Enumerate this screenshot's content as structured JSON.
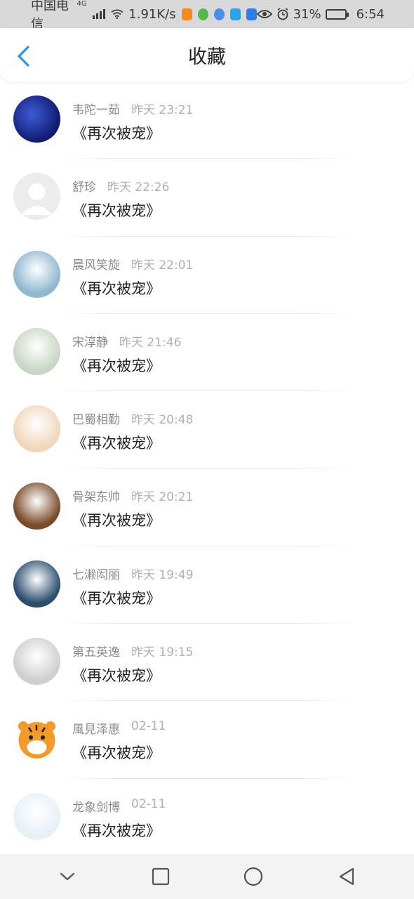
{
  "status_bar": {
    "carrier": "中国电信",
    "network_type": "4G",
    "speed": "1.91K/s",
    "battery": "31%",
    "time": "6:54"
  },
  "header": {
    "title": "收藏",
    "back_icon": "chevron-left-icon"
  },
  "items": [
    {
      "name": "韦陀一茹",
      "time": "昨天 23:21",
      "content": "《再次被宠》",
      "avatar_color": "#1a2a8a"
    },
    {
      "name": "舒珍",
      "time": "昨天 22:26",
      "content": "《再次被宠》",
      "avatar_color": "#e9e9e9"
    },
    {
      "name": "晨风笑旋",
      "time": "昨天 22:01",
      "content": "《再次被宠》",
      "avatar_color": "#8fb8d0"
    },
    {
      "name": "宋淳静",
      "time": "昨天 21:46",
      "content": "《再次被宠》",
      "avatar_color": "#c9d6c4"
    },
    {
      "name": "巴蜀相勤",
      "time": "昨天 20:48",
      "content": "《再次被宠》",
      "avatar_color": "#f0d7bc"
    },
    {
      "name": "骨架东帅",
      "time": "昨天 20:21",
      "content": "《再次被宠》",
      "avatar_color": "#7a4a2a"
    },
    {
      "name": "七濑闳丽",
      "time": "昨天 19:49",
      "content": "《再次被宠》",
      "avatar_color": "#2c4d6e"
    },
    {
      "name": "第五英逸",
      "time": "昨天 19:15",
      "content": "《再次被宠》",
      "avatar_color": "#cfcfcf"
    },
    {
      "name": "風見泽惠",
      "time": "02-11",
      "content": "《再次被宠》",
      "avatar_color": "#f09a2a"
    },
    {
      "name": "龙象剑博",
      "time": "02-11",
      "content": "《再次被宠》",
      "avatar_color": "#e6f1f6"
    }
  ],
  "nav_bar": {
    "buttons": [
      "chevron-down-icon",
      "square-icon",
      "circle-icon",
      "triangle-back-icon"
    ]
  },
  "colors": {
    "accent": "#2b95e8",
    "status_bar_bg": "#d9d9d9",
    "name_text": "#8a8a8a",
    "time_text": "#b0b0b0"
  }
}
